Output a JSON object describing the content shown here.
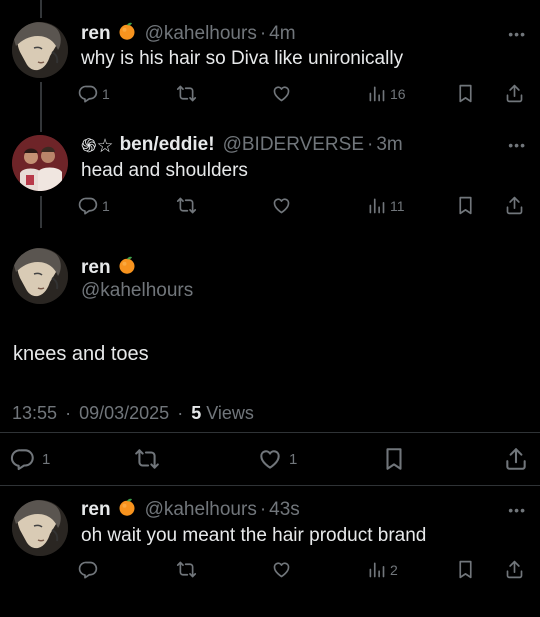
{
  "replies_top": [
    {
      "name": "ren",
      "emoji": "orange-emoji",
      "handle": "@kahelhours",
      "separator": "·",
      "time": "4m",
      "more": "•••",
      "text": "why is his hair so Diva like unironically",
      "reply_count": "1",
      "view_count": "16"
    },
    {
      "name": "ben/eddie!",
      "name_prefix": "֍☆",
      "handle": "@BIDERVERSE",
      "separator": "·",
      "time": "3m",
      "more": "•••",
      "text": "head and shoulders",
      "reply_count": "1",
      "view_count": "11"
    }
  ],
  "main_post": {
    "name": "ren",
    "emoji": "orange-emoji",
    "handle": "@kahelhours",
    "text": "knees and toes",
    "time": "13:55",
    "separator": "·",
    "date": "09/03/2025",
    "views_count": "5",
    "views_label": "Views",
    "reply_count": "1",
    "like_count": "1"
  },
  "reply_bottom": {
    "name": "ren",
    "emoji": "orange-emoji",
    "handle": "@kahelhours",
    "separator": "·",
    "time": "43s",
    "more": "•••",
    "text": "oh wait you meant the hair product brand",
    "view_count": "2"
  },
  "colors": {
    "background": "#000000",
    "text": "#e7e9ea",
    "muted": "#71767b",
    "divider": "#2f3336",
    "orange": "#f7931e"
  }
}
